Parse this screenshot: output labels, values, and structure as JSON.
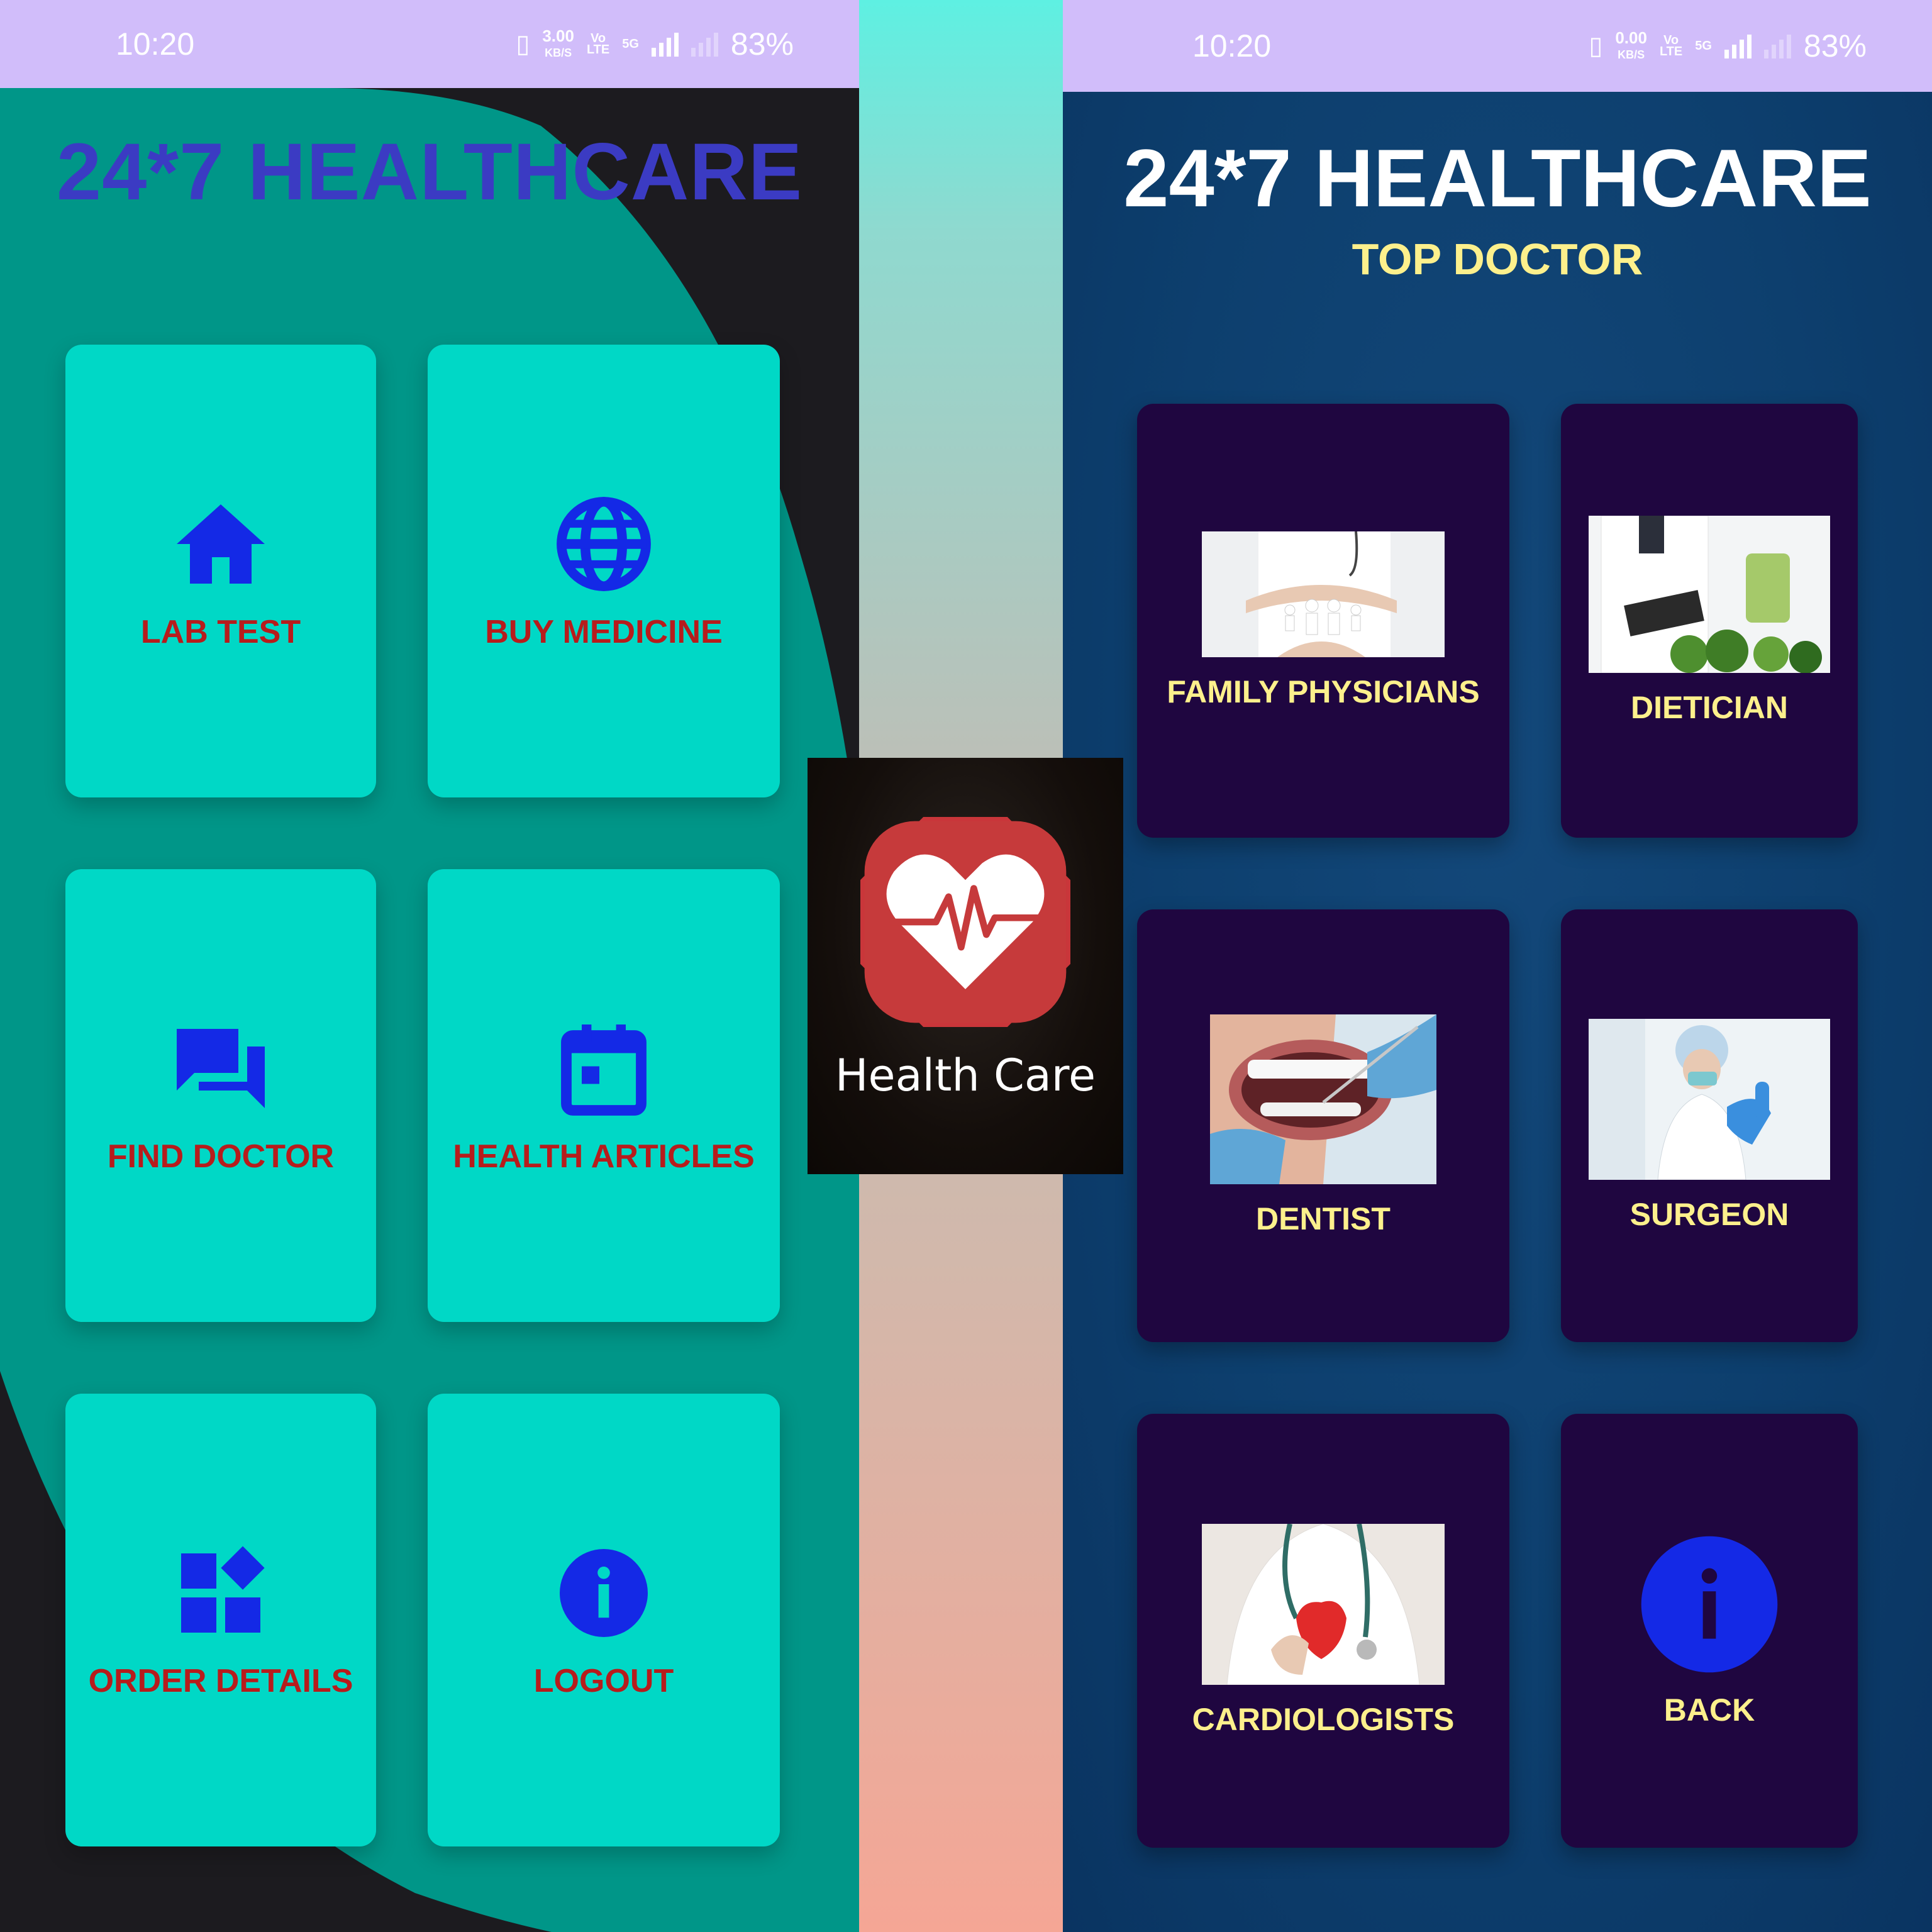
{
  "status_left": {
    "time": "10:20",
    "speed_value": "3.00",
    "speed_unit": "KB/S",
    "volte_top": "Vo",
    "volte_bottom": "LTE",
    "network": "5G",
    "battery": "83%"
  },
  "status_right": {
    "time": "10:20",
    "speed_value": "0.00",
    "speed_unit": "KB/S",
    "volte_top": "Vo",
    "volte_bottom": "LTE",
    "network": "5G",
    "battery": "83%"
  },
  "home": {
    "title": "24*7 HEALTHCARE",
    "cards": [
      {
        "label": "LAB TEST",
        "icon": "home-icon"
      },
      {
        "label": "BUY MEDICINE",
        "icon": "globe-icon"
      },
      {
        "label": "FIND DOCTOR",
        "icon": "chat-icon"
      },
      {
        "label": "HEALTH ARTICLES",
        "icon": "calendar-icon"
      },
      {
        "label": "ORDER DETAILS",
        "icon": "widgets-icon"
      },
      {
        "label": "LOGOUT",
        "icon": "info-icon"
      }
    ]
  },
  "app_icon": {
    "name": "Health Care",
    "icon": "heart-pulse-icon"
  },
  "top_doctor": {
    "title": "24*7 HEALTHCARE",
    "subtitle": "TOP DOCTOR",
    "cards": [
      {
        "label": "FAMILY PHYSICIANS",
        "image": "family-care-photo"
      },
      {
        "label": "DIETICIAN",
        "image": "dietician-photo"
      },
      {
        "label": "DENTIST",
        "image": "dentist-photo"
      },
      {
        "label": "SURGEON",
        "image": "surgeon-photo"
      },
      {
        "label": "CARDIOLOGISTS",
        "image": "cardiologist-photo"
      },
      {
        "label": "BACK",
        "icon": "info-icon"
      }
    ]
  },
  "colors": {
    "teal_card": "#00d8c6",
    "teal_blob": "#009688",
    "label_red": "#b71c1c",
    "icon_blue": "#1429e6",
    "navy_bg": "#0d3f6e",
    "purple_card": "#1f0640",
    "label_yellow": "#fdf08c",
    "status_bar": "#d1bdfa"
  }
}
